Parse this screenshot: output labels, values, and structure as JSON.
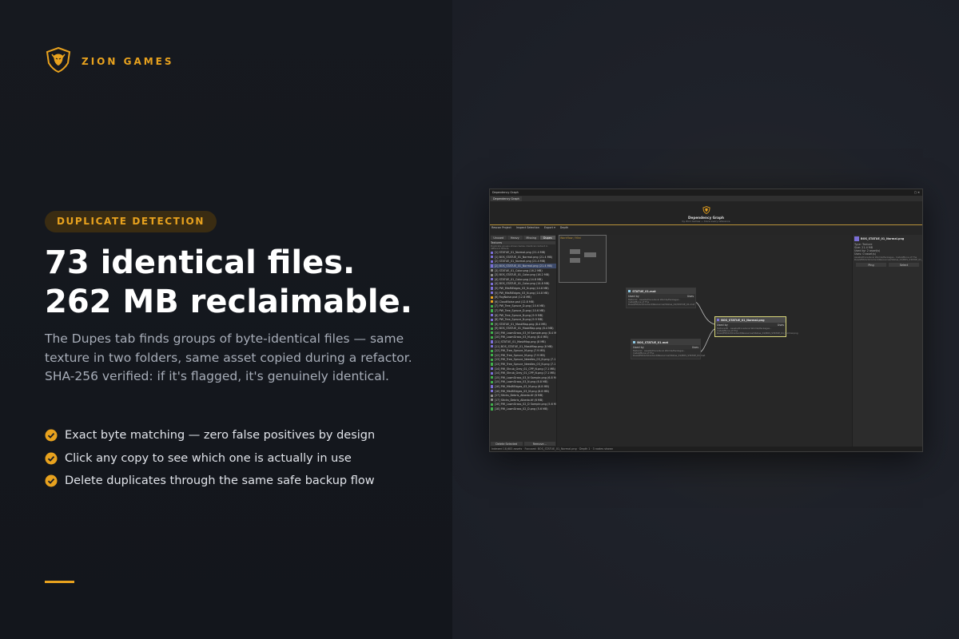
{
  "brand": {
    "name": "ZION GAMES",
    "logo_icon": "lion-head-shield-icon",
    "accent": "#e8a21e"
  },
  "badge": "DUPLICATE DETECTION",
  "headline": {
    "line1": "73 identical files.",
    "line2": "262 MB reclaimable."
  },
  "description": "The Dupes tab finds groups of byte-identical files — same texture in two folders, same asset copied during a refactor. SHA-256 verified: if it's flagged, it's genuinely identical.",
  "bullets": [
    {
      "text": "Exact byte matching — zero false positives by design",
      "icon": "check-circle-icon"
    },
    {
      "text": "Click any copy to see which one is actually in use",
      "icon": "check-circle-icon"
    },
    {
      "text": "Delete duplicates through the same safe backup flow",
      "icon": "check-circle-icon"
    }
  ],
  "screenshot": {
    "window_title": "Dependency Graph",
    "tab": "Dependency Graph",
    "header_title": "Dependency Graph",
    "header_subtitle": "by Zion Games — trace every reference",
    "toolbar": [
      "Rescan Project",
      "Inspect Selection",
      "Export ▾",
      "Depth"
    ],
    "subtabs": [
      "Unused",
      "Heavy",
      "Missing",
      "Dupes"
    ],
    "search_label": "Textures",
    "list_note": "Duplicate groups shown below. Identical content in different folders.",
    "list_rows": [
      "[1] STATUE_01_Normal.png (21.4 MB)",
      "[1] BOS_STATUE_01_Normal.png (21.4 MB)",
      "[2] STATUE_01_Normal.png (21.4 MB)",
      "[2] BOS_STATUE_01_Normal.png (21.4 MB)",
      "[3] STATUE_01_Color.png (16.2 MB)",
      "[3] BOS_STATUE_01_Color.png (16.2 MB)",
      "[4] STATUE_01_Color.png (14.8 MB)",
      "[4] BOS_STATUE_01_Color.png (14.8 MB)",
      "[5] PW_MtsRiEdges_03_N.png (14.8 MB)",
      "[5] PW_MtsRiEdges_03_N.png (14.8 MB)",
      "[6] FogNoise.psd (12.8 MB)",
      "[6] CloudNoise.psd (12.8 MB)",
      "[7] PW_Tree_Spruce_D.png (10.6 MB)",
      "[7] PW_Tree_Spruce_D.png (10.6 MB)",
      "[8] PW_Tree_Spruce_N.png (9.9 MB)",
      "[8] PW_Tree_Spruce_N.png (9.9 MB)",
      "[9] STATUE_01_MaskMap.png (8.4 MB)",
      "[9] BOS_STATUE_01_MaskMap.png (8.4 MB)",
      "[10] PW_LawnGrass_03_M Sample.png (8.4 MB)",
      "[10] PW_LawnGrass_03_M.png (8.4 MB)",
      "[11] STATUE_01_MaskMap.png (8 MB)",
      "[11] BOS_STATUE_01_MaskMap.png (8 MB)",
      "[12] PW_Tree_Spruce_M.png (7.9 MB)",
      "[12] PW_Tree_Spruce_M.png (7.9 MB)",
      "[13] PW_Tree_Spruce_Needles_03_N.png (7.1 MB)",
      "[13] PW_Tree_Spruce_Needles_03_N.png (7.1 MB)",
      "[14] PW_Shrub_Grey_01_CPP_N.png (7.1 MB)",
      "[14] PW_Shrub_Grey_01_CPP_N.png (7.1 MB)",
      "[15] PW_LawnGrass_03_N Sample.png (6.8 MB)",
      "[15] PW_LawnGrass_03_N.png (6.8 MB)",
      "[16] PW_MtsRiEdges_03_M.png (6.8 MB)",
      "[16] PW_MtsRiEdges_03_M.png (6.8 MB)",
      "[17] Sticks_Debris_Albedo.tif (6 MB)",
      "[17] Sticks_Debris_Albedo.tif (6 MB)",
      "[18] PW_LawnGrass_02_D Sample.png (5.6 MB)",
      "[18] PW_LawnGrass_02_D.png (5.6 MB)"
    ],
    "list_buttons": [
      "Delete Selected",
      "Remove..."
    ],
    "preview_label": "Workflow / Mini",
    "nodes": [
      {
        "title": "STATUE_01.mat",
        "pin_in": "Used by",
        "pin_out": "Uses",
        "text": "Material · Assets/Procedural Worlds/Packages - Install/Bone of The Dead/PW/Art/Content/Resources/Statue_01/STATUE_01.mat"
      },
      {
        "title": "BOS_STATUE_01.mat",
        "pin_in": "Used by",
        "pin_out": "Uses",
        "text": "Material · Assets/Procedural Worlds/Packages - Install/Bone of The Dead/PW/Art/Content/Resources/Statue_01/BOS_STATUE_01.mat"
      },
      {
        "title": "BOS_STATUE_01_Normal.png",
        "pin_in": "Used by",
        "pin_out": "Uses",
        "text": "Texture2D · Assets/Procedural Worlds/Packages - Install/Bone of The Dead/PW/Art/Content/Resources/Statue_01/BOS_STATUE_01_Normal.png"
      }
    ],
    "inspector": {
      "title": "BOS_STATUE_01_Normal.png",
      "lines": [
        "Type: Texture",
        "Size: 21.4 MB",
        "Used by: 2 asset(s)",
        "Uses: 0 asset(s)"
      ],
      "path": "Assets/Procedural Worlds/Packages - Install/Bone of The Dead/PW/Art/Content/Resources/Statue_01/BOS_STATUE_01_Normal.png",
      "buttons": [
        "Ping",
        "Select"
      ]
    },
    "status": "Indexed 18,683 assets · Focused: BOS_STATUE_01_Normal.png · Depth 1 · 3 nodes shown"
  }
}
